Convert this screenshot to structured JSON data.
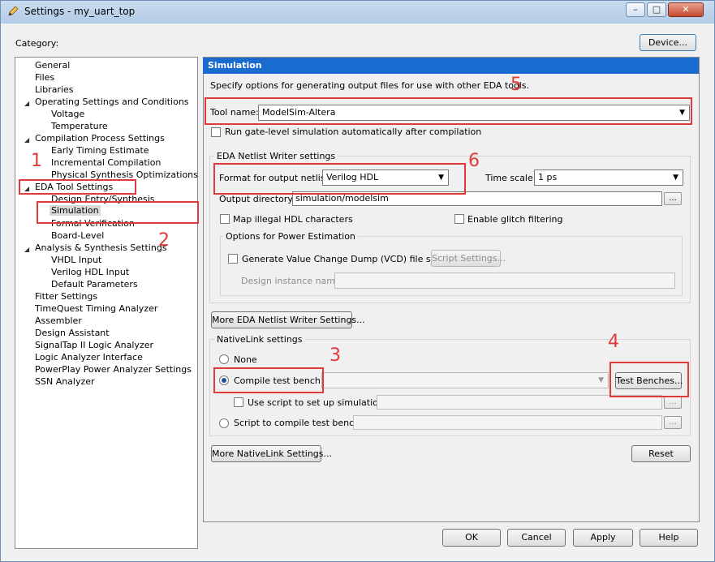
{
  "window": {
    "title": "Settings - my_uart_top"
  },
  "category_label": "Category:",
  "device_button": "Device...",
  "tree": [
    {
      "label": "General",
      "level": 0
    },
    {
      "label": "Files",
      "level": 0
    },
    {
      "label": "Libraries",
      "level": 0
    },
    {
      "label": "Operating Settings and Conditions",
      "level": 0,
      "expanded": true
    },
    {
      "label": "Voltage",
      "level": 1
    },
    {
      "label": "Temperature",
      "level": 1
    },
    {
      "label": "Compilation Process Settings",
      "level": 0,
      "expanded": true
    },
    {
      "label": "Early Timing Estimate",
      "level": 1
    },
    {
      "label": "Incremental Compilation",
      "level": 1
    },
    {
      "label": "Physical Synthesis Optimizations",
      "level": 1
    },
    {
      "label": "EDA Tool Settings",
      "level": 0,
      "expanded": true
    },
    {
      "label": "Design Entry/Synthesis",
      "level": 1
    },
    {
      "label": "Simulation",
      "level": 1,
      "selected": true
    },
    {
      "label": "Formal Verification",
      "level": 1
    },
    {
      "label": "Board-Level",
      "level": 1
    },
    {
      "label": "Analysis & Synthesis Settings",
      "level": 0,
      "expanded": true
    },
    {
      "label": "VHDL Input",
      "level": 1
    },
    {
      "label": "Verilog HDL Input",
      "level": 1
    },
    {
      "label": "Default Parameters",
      "level": 1
    },
    {
      "label": "Fitter Settings",
      "level": 0
    },
    {
      "label": "TimeQuest Timing Analyzer",
      "level": 0
    },
    {
      "label": "Assembler",
      "level": 0
    },
    {
      "label": "Design Assistant",
      "level": 0
    },
    {
      "label": "SignalTap II Logic Analyzer",
      "level": 0
    },
    {
      "label": "Logic Analyzer Interface",
      "level": 0
    },
    {
      "label": "PowerPlay Power Analyzer Settings",
      "level": 0
    },
    {
      "label": "SSN Analyzer",
      "level": 0
    }
  ],
  "panel": {
    "heading": "Simulation",
    "description": "Specify options for generating output files for use with other EDA tools.",
    "tool_name_label": "Tool name:",
    "tool_name_value": "ModelSim-Altera",
    "run_gate_level": "Run gate-level simulation automatically after compilation",
    "netlist_group": "EDA Netlist Writer settings",
    "format_label": "Format for output netlist:",
    "format_value": "Verilog HDL",
    "time_scale_label": "Time scale:",
    "time_scale_value": "1 ps",
    "output_dir_label": "Output directory:",
    "output_dir_value": "simulation/modelsim",
    "browse": "...",
    "map_illegal": "Map illegal HDL characters",
    "enable_glitch": "Enable glitch filtering",
    "power_group": "Options for Power Estimation",
    "gen_vcd": "Generate Value Change Dump (VCD) file script",
    "script_settings": "Script Settings...",
    "design_instance_label": "Design instance name:",
    "more_netlist_btn": "More EDA Netlist Writer Settings...",
    "nativelink_group": "NativeLink settings",
    "none_label": "None",
    "compile_tb_label": "Compile test bench:",
    "test_benches_btn": "Test Benches...",
    "use_script_label": "Use script to set up simulation:",
    "script_compile_label": "Script to compile test bench:",
    "more_nativelink_btn": "More NativeLink Settings...",
    "reset_btn": "Reset"
  },
  "footer": {
    "ok": "OK",
    "cancel": "Cancel",
    "apply": "Apply",
    "help": "Help"
  },
  "annotations": [
    "1",
    "2",
    "3",
    "4",
    "5",
    "6"
  ],
  "colors": {
    "annotation": "#e03a3a",
    "heading_bg": "#1a6bd0"
  }
}
